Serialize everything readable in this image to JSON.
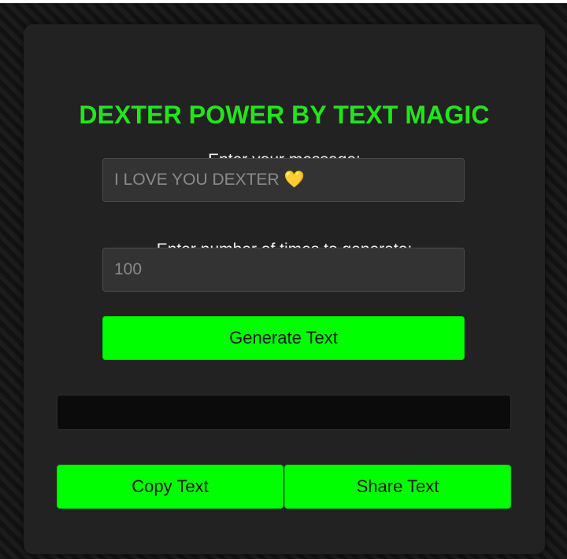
{
  "title": "DEXTER POWER BY TEXT MAGIC",
  "message": {
    "label": "Enter your message:",
    "placeholder": "I LOVE YOU DEXTER 💛"
  },
  "count": {
    "label": "Enter number of times to generate:",
    "placeholder": "100"
  },
  "buttons": {
    "generate": "Generate Text",
    "copy": "Copy Text",
    "share": "Share Text"
  },
  "output": {
    "value": ""
  },
  "colors": {
    "accent": "#00ff00",
    "title": "#22e51c",
    "card": "#222222",
    "field": "#333333",
    "output": "#0b0b0b"
  }
}
